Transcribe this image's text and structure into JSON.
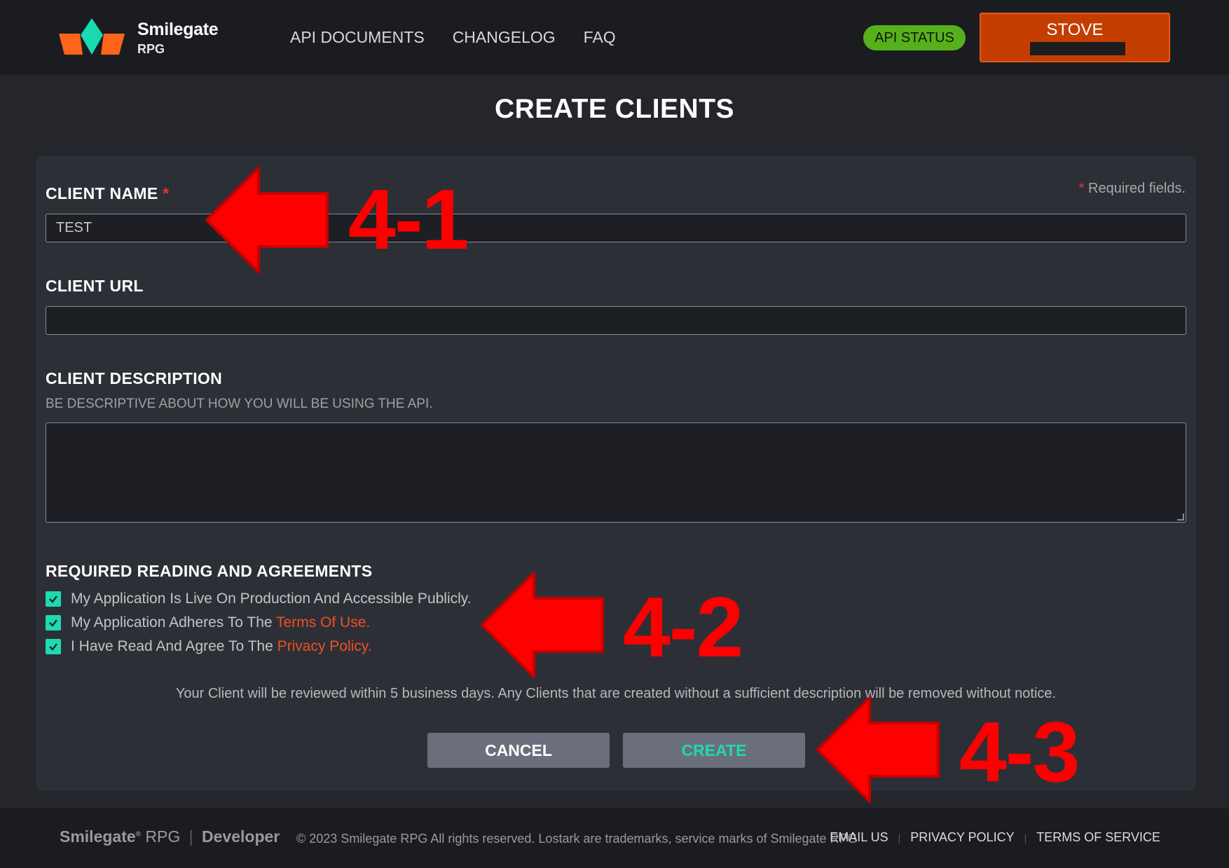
{
  "header": {
    "logo": {
      "word": "Smilegate",
      "sub": "RPG"
    },
    "nav": [
      "API DOCUMENTS",
      "CHANGELOG",
      "FAQ"
    ],
    "api_status": "API STATUS",
    "stove": "STOVE"
  },
  "page_title": "CREATE CLIENTS",
  "form": {
    "required_note": "Required fields.",
    "required_star": "*",
    "client_name": {
      "label": "CLIENT NAME",
      "value": "TEST"
    },
    "client_url": {
      "label": "CLIENT URL",
      "value": ""
    },
    "client_description": {
      "label": "CLIENT DESCRIPTION",
      "hint": "BE DESCRIPTIVE ABOUT HOW YOU WILL BE USING THE API.",
      "value": ""
    },
    "agreements": {
      "title": "REQUIRED READING AND AGREEMENTS",
      "items": [
        {
          "text": "My Application Is Live On Production And Accessible Publicly.",
          "link": "",
          "checked": true
        },
        {
          "text": "My Application Adheres To The ",
          "link": "Terms Of Use.",
          "checked": true
        },
        {
          "text": "I Have Read And Agree To The ",
          "link": "Privacy Policy.",
          "checked": true
        }
      ]
    },
    "review_note": "Your Client will be reviewed within 5 business days. Any Clients that are created without a sufficient description will be removed without notice.",
    "cancel_label": "CANCEL",
    "create_label": "CREATE"
  },
  "footer": {
    "logo_brand": "Smilegate",
    "logo_reg": "®",
    "logo_rpg": "RPG",
    "logo_sep": "|",
    "logo_dev": "Developer",
    "copyright": "© 2023 Smilegate RPG All rights reserved. Lostark are trademarks, service marks of Smilegate RPG",
    "links": [
      "EMAIL US",
      "PRIVACY POLICY",
      "TERMS OF SERVICE"
    ],
    "link_divider": "|"
  },
  "annotations": [
    "4-1",
    "4-2",
    "4-3"
  ],
  "colors": {
    "accent_orange": "#c43e00",
    "status_green": "#56b01c",
    "check_teal": "#1ddab3",
    "annotation_red": "#ff0000"
  }
}
